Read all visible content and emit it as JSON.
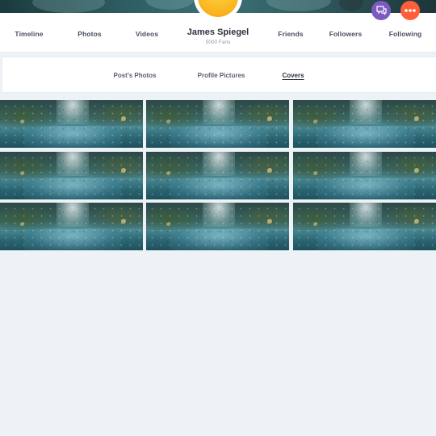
{
  "profile": {
    "name": "James Spiegel",
    "fans": "5000 Fans"
  },
  "nav": {
    "timeline": "Timeline",
    "photos": "Photos",
    "videos": "Videos",
    "friends": "Friends",
    "followers": "Followers",
    "following": "Following"
  },
  "actions": {
    "chat_icon": "chat-bubble-icon",
    "more_icon": "more-dots-icon",
    "chat_color": "#7c5ac2",
    "more_color": "#ff5e3a"
  },
  "sub_tabs": {
    "posts_photos": "Post's Photos",
    "profile_pictures": "Profile Pictures",
    "covers": "Covers",
    "active": "Covers"
  },
  "covers": {
    "image_subject": "rainy-street-cover",
    "rows": 3,
    "columns": 3
  }
}
